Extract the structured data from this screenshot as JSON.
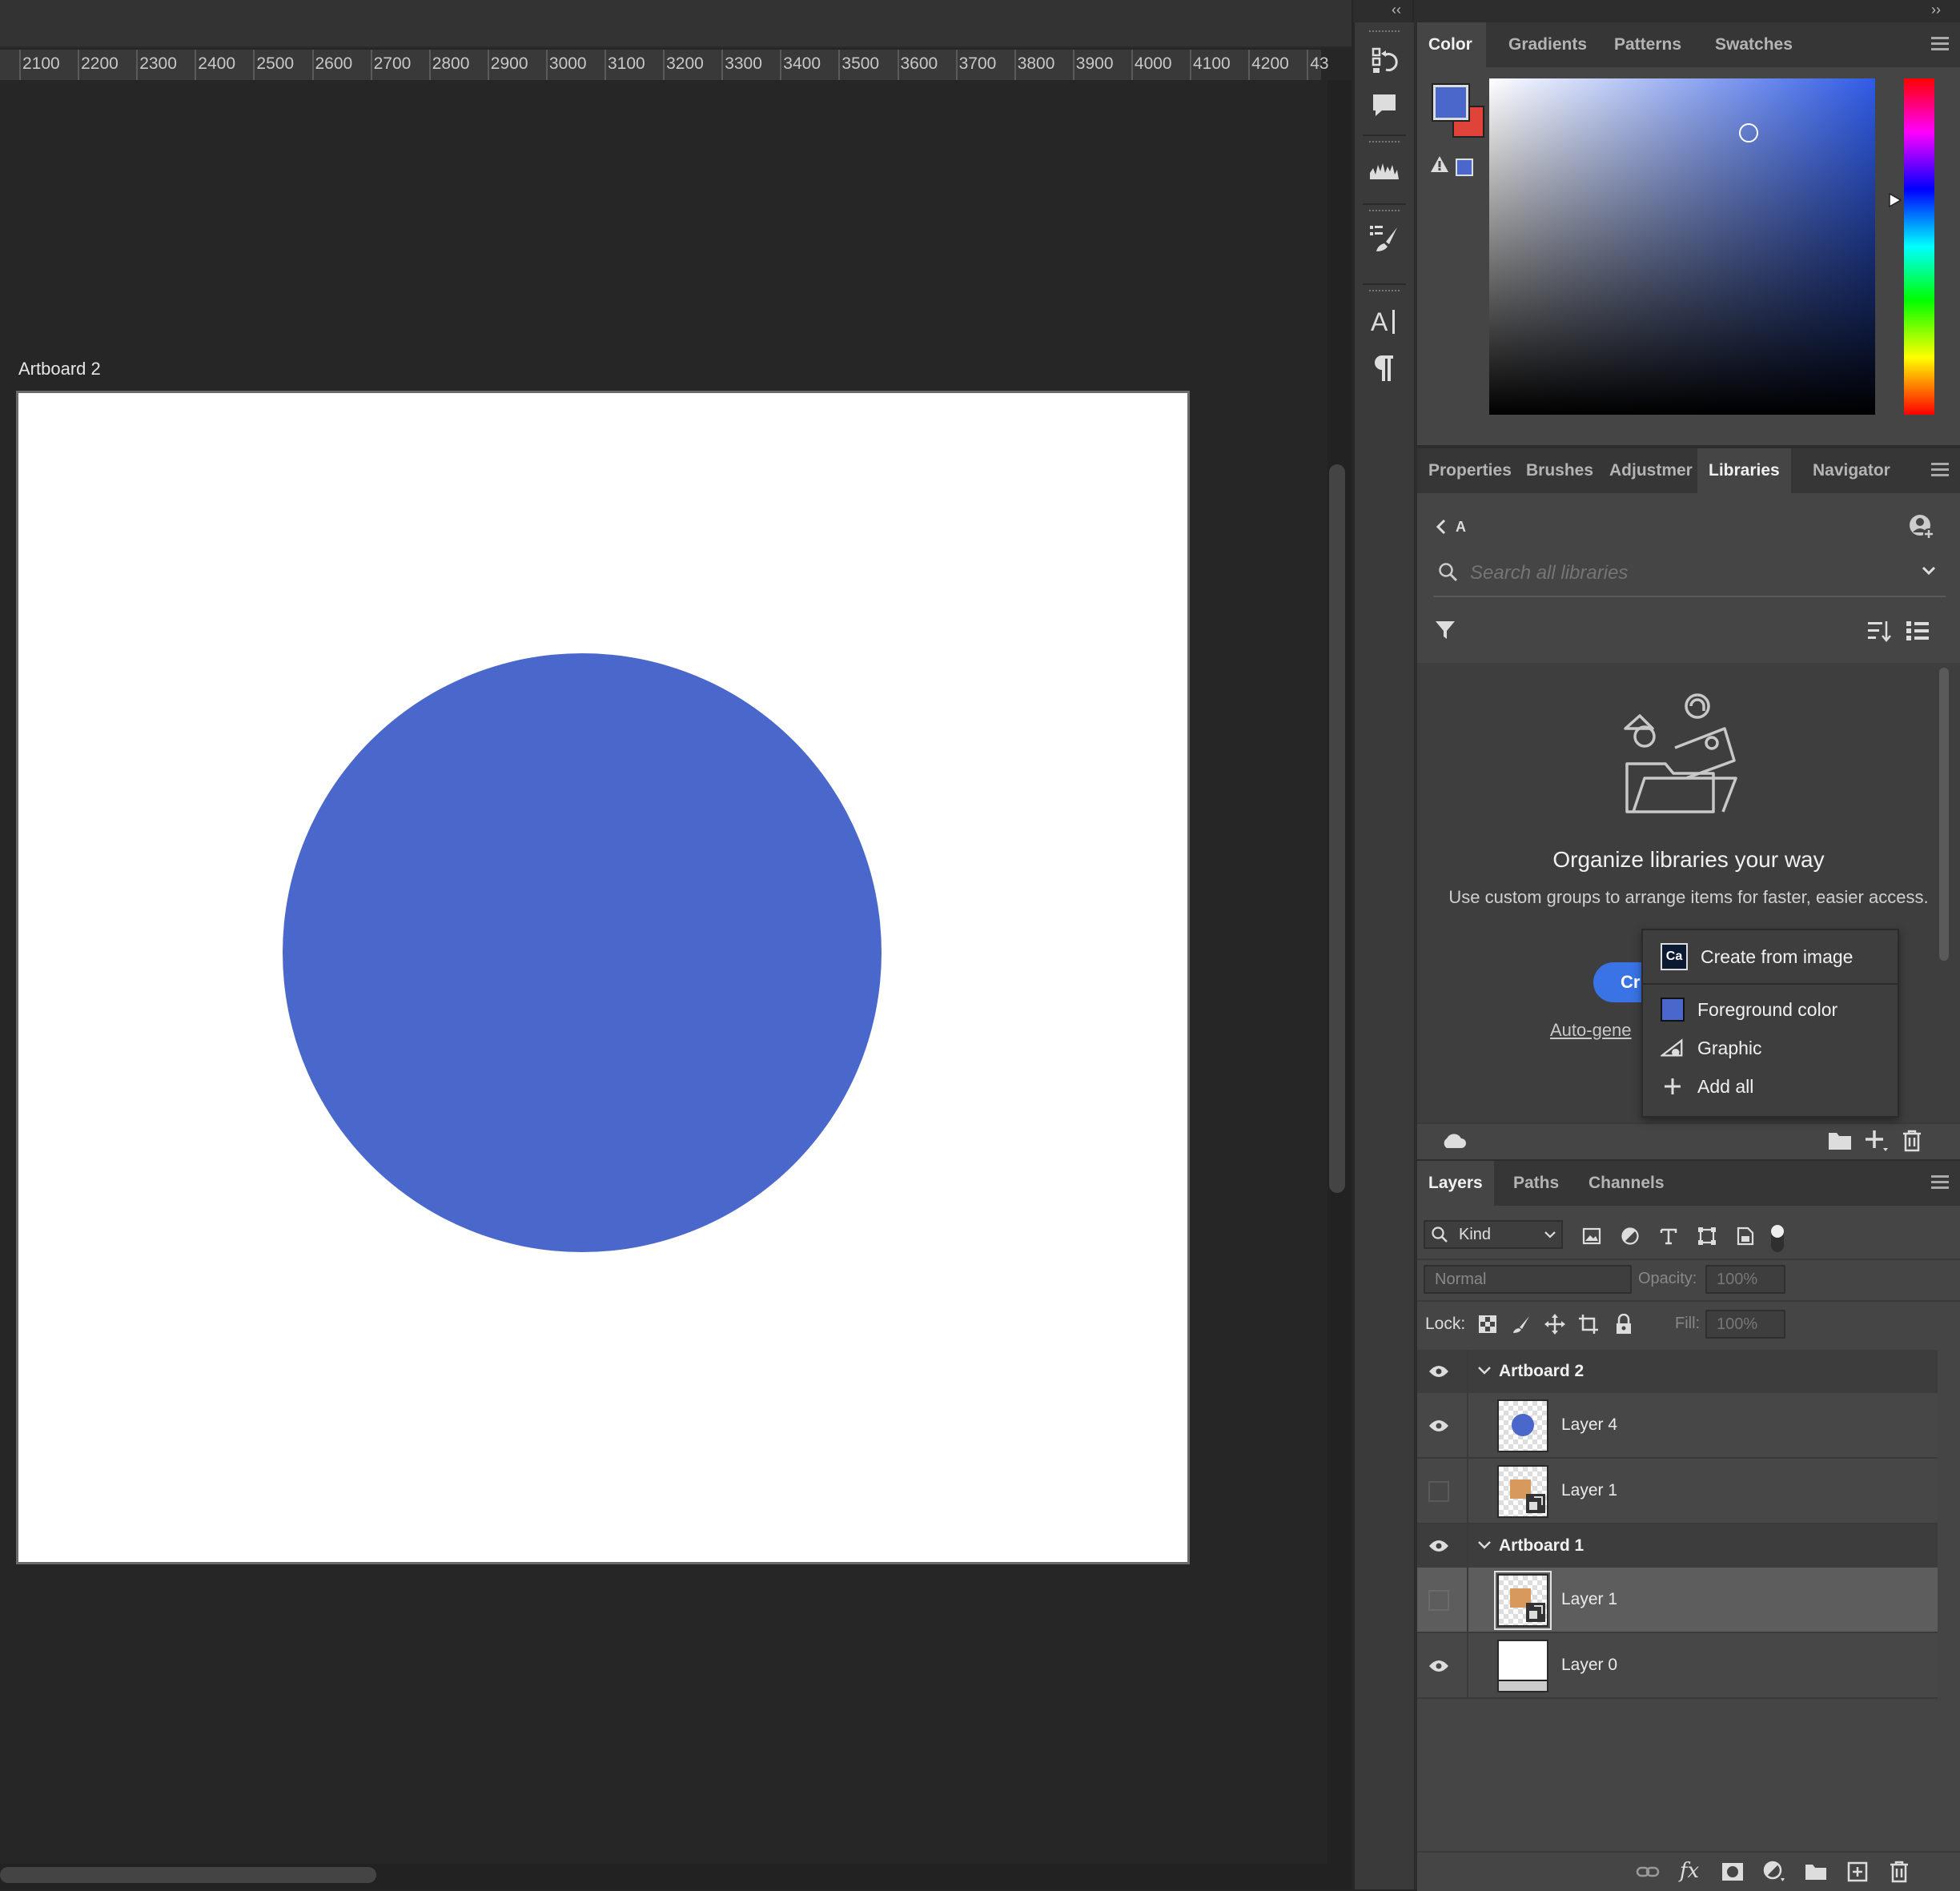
{
  "ruler": {
    "labels": [
      "2100",
      "2200",
      "2300",
      "2400",
      "2500",
      "2600",
      "2700",
      "2800",
      "2900",
      "3000",
      "3100",
      "3200",
      "3300",
      "3400",
      "3500",
      "3600",
      "3700",
      "3800",
      "3900",
      "4000",
      "4100",
      "4200",
      "43"
    ]
  },
  "canvas": {
    "artboard_label": "Artboard 2",
    "circle_color": "#4a67cb"
  },
  "color_panel": {
    "tabs": [
      "Color",
      "Gradients",
      "Patterns",
      "Swatches"
    ],
    "active_tab": "Color",
    "foreground": "#4a67cb",
    "background": "#e0433a"
  },
  "libraries_panel": {
    "tabs": [
      "Properties",
      "Brushes",
      "Adjustmer",
      "Libraries",
      "Navigator"
    ],
    "active_tab": "Libraries",
    "breadcrumb": "A",
    "search_placeholder": "Search all libraries",
    "empty_title": "Organize libraries your way",
    "empty_desc": "Use custom groups to arrange items for faster, easier access.",
    "create_button": "Cr",
    "auto_link": "Auto-gene",
    "menu": {
      "create_from_image": "Create from image",
      "create_from_image_badge": "Ca",
      "foreground_color": "Foreground color",
      "graphic": "Graphic",
      "add_all": "Add all"
    }
  },
  "layers_panel": {
    "tabs": [
      "Layers",
      "Paths",
      "Channels"
    ],
    "active_tab": "Layers",
    "filter_kind": "Kind",
    "blend_mode": "Normal",
    "opacity_label": "Opacity:",
    "opacity_value": "100%",
    "lock_label": "Lock:",
    "fill_label": "Fill:",
    "fill_value": "100%",
    "groups": [
      {
        "name": "Artboard 2",
        "layers": [
          {
            "name": "Layer 4",
            "visible": true
          },
          {
            "name": "Layer 1",
            "visible": false
          }
        ]
      },
      {
        "name": "Artboard 1",
        "layers": [
          {
            "name": "Layer 1",
            "visible": false,
            "selected": true
          },
          {
            "name": "Layer 0",
            "visible": true
          }
        ]
      }
    ]
  }
}
